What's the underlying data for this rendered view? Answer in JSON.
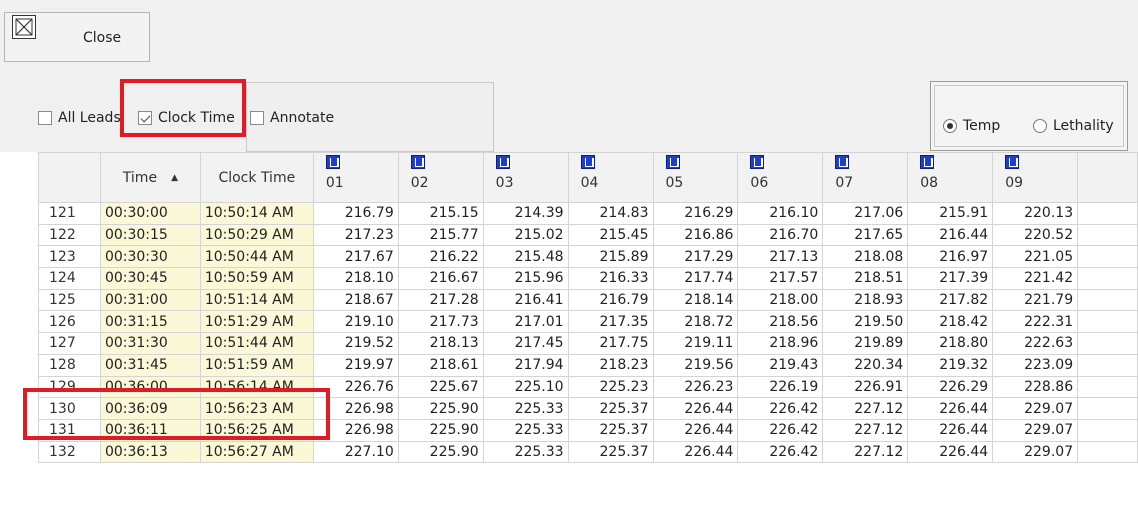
{
  "toolbar": {
    "close_label": "Close"
  },
  "options": {
    "all_leads_label": "All Leads",
    "all_leads_checked": false,
    "clock_time_label": "Clock Time",
    "clock_time_checked": true,
    "annotate_label": "Annotate",
    "annotate_checked": false
  },
  "mode": {
    "temp_label": "Temp",
    "lethality_label": "Lethality",
    "selected": "Temp"
  },
  "table": {
    "time_header": "Time",
    "clock_header": "Clock Time",
    "lead_headers": [
      "01",
      "02",
      "03",
      "04",
      "05",
      "06",
      "07",
      "08",
      "09"
    ],
    "rows": [
      {
        "n": "121",
        "time": "00:30:00",
        "clock": "10:50:14 AM",
        "v": [
          "216.79",
          "215.15",
          "214.39",
          "214.83",
          "216.29",
          "216.10",
          "217.06",
          "215.91",
          "220.13"
        ]
      },
      {
        "n": "122",
        "time": "00:30:15",
        "clock": "10:50:29 AM",
        "v": [
          "217.23",
          "215.77",
          "215.02",
          "215.45",
          "216.86",
          "216.70",
          "217.65",
          "216.44",
          "220.52"
        ]
      },
      {
        "n": "123",
        "time": "00:30:30",
        "clock": "10:50:44 AM",
        "v": [
          "217.67",
          "216.22",
          "215.48",
          "215.89",
          "217.29",
          "217.13",
          "218.08",
          "216.97",
          "221.05"
        ]
      },
      {
        "n": "124",
        "time": "00:30:45",
        "clock": "10:50:59 AM",
        "v": [
          "218.10",
          "216.67",
          "215.96",
          "216.33",
          "217.74",
          "217.57",
          "218.51",
          "217.39",
          "221.42"
        ]
      },
      {
        "n": "125",
        "time": "00:31:00",
        "clock": "10:51:14 AM",
        "v": [
          "218.67",
          "217.28",
          "216.41",
          "216.79",
          "218.14",
          "218.00",
          "218.93",
          "217.82",
          "221.79"
        ]
      },
      {
        "n": "126",
        "time": "00:31:15",
        "clock": "10:51:29 AM",
        "v": [
          "219.10",
          "217.73",
          "217.01",
          "217.35",
          "218.72",
          "218.56",
          "219.50",
          "218.42",
          "222.31"
        ]
      },
      {
        "n": "127",
        "time": "00:31:30",
        "clock": "10:51:44 AM",
        "v": [
          "219.52",
          "218.13",
          "217.45",
          "217.75",
          "219.11",
          "218.96",
          "219.89",
          "218.80",
          "222.63"
        ]
      },
      {
        "n": "128",
        "time": "00:31:45",
        "clock": "10:51:59 AM",
        "v": [
          "219.97",
          "218.61",
          "217.94",
          "218.23",
          "219.56",
          "219.43",
          "220.34",
          "219.32",
          "223.09"
        ]
      },
      {
        "n": "129",
        "time": "00:36:00",
        "clock": "10:56:14 AM",
        "v": [
          "226.76",
          "225.67",
          "225.10",
          "225.23",
          "226.23",
          "226.19",
          "226.91",
          "226.29",
          "228.86"
        ]
      },
      {
        "n": "130",
        "time": "00:36:09",
        "clock": "10:56:23 AM",
        "v": [
          "226.98",
          "225.90",
          "225.33",
          "225.37",
          "226.44",
          "226.42",
          "227.12",
          "226.44",
          "229.07"
        ]
      },
      {
        "n": "131",
        "time": "00:36:11",
        "clock": "10:56:25 AM",
        "v": [
          "226.98",
          "225.90",
          "225.33",
          "225.37",
          "226.44",
          "226.42",
          "227.12",
          "226.44",
          "229.07"
        ]
      },
      {
        "n": "132",
        "time": "00:36:13",
        "clock": "10:56:27 AM",
        "v": [
          "227.10",
          "225.90",
          "225.33",
          "225.37",
          "226.44",
          "226.42",
          "227.12",
          "226.44",
          "229.07"
        ]
      }
    ]
  },
  "colors": {
    "highlight": "#e01b24",
    "time_cell_bg": "#fbf8d8",
    "lead_icon": "#1f3fc8"
  }
}
